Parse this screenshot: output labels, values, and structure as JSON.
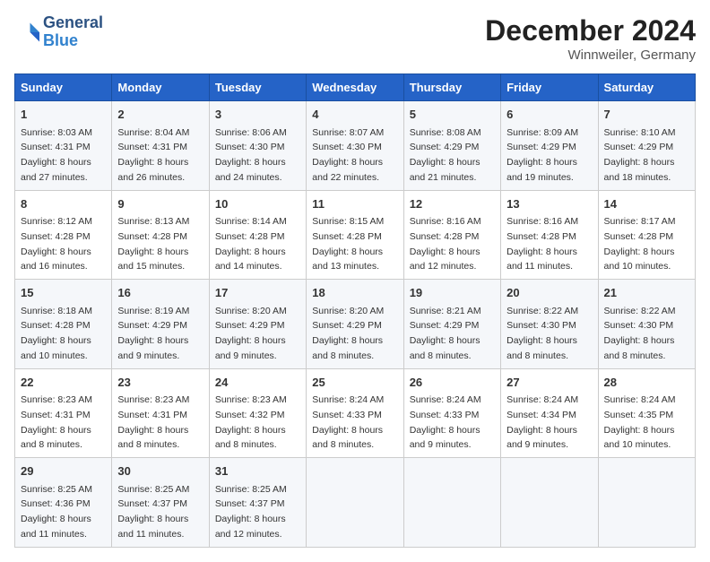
{
  "header": {
    "logo_line1": "General",
    "logo_line2": "Blue",
    "month": "December 2024",
    "location": "Winnweiler, Germany"
  },
  "weekdays": [
    "Sunday",
    "Monday",
    "Tuesday",
    "Wednesday",
    "Thursday",
    "Friday",
    "Saturday"
  ],
  "weeks": [
    [
      {
        "day": "1",
        "sunrise": "8:03 AM",
        "sunset": "4:31 PM",
        "daylight": "8 hours and 27 minutes."
      },
      {
        "day": "2",
        "sunrise": "8:04 AM",
        "sunset": "4:31 PM",
        "daylight": "8 hours and 26 minutes."
      },
      {
        "day": "3",
        "sunrise": "8:06 AM",
        "sunset": "4:30 PM",
        "daylight": "8 hours and 24 minutes."
      },
      {
        "day": "4",
        "sunrise": "8:07 AM",
        "sunset": "4:30 PM",
        "daylight": "8 hours and 22 minutes."
      },
      {
        "day": "5",
        "sunrise": "8:08 AM",
        "sunset": "4:29 PM",
        "daylight": "8 hours and 21 minutes."
      },
      {
        "day": "6",
        "sunrise": "8:09 AM",
        "sunset": "4:29 PM",
        "daylight": "8 hours and 19 minutes."
      },
      {
        "day": "7",
        "sunrise": "8:10 AM",
        "sunset": "4:29 PM",
        "daylight": "8 hours and 18 minutes."
      }
    ],
    [
      {
        "day": "8",
        "sunrise": "8:12 AM",
        "sunset": "4:28 PM",
        "daylight": "8 hours and 16 minutes."
      },
      {
        "day": "9",
        "sunrise": "8:13 AM",
        "sunset": "4:28 PM",
        "daylight": "8 hours and 15 minutes."
      },
      {
        "day": "10",
        "sunrise": "8:14 AM",
        "sunset": "4:28 PM",
        "daylight": "8 hours and 14 minutes."
      },
      {
        "day": "11",
        "sunrise": "8:15 AM",
        "sunset": "4:28 PM",
        "daylight": "8 hours and 13 minutes."
      },
      {
        "day": "12",
        "sunrise": "8:16 AM",
        "sunset": "4:28 PM",
        "daylight": "8 hours and 12 minutes."
      },
      {
        "day": "13",
        "sunrise": "8:16 AM",
        "sunset": "4:28 PM",
        "daylight": "8 hours and 11 minutes."
      },
      {
        "day": "14",
        "sunrise": "8:17 AM",
        "sunset": "4:28 PM",
        "daylight": "8 hours and 10 minutes."
      }
    ],
    [
      {
        "day": "15",
        "sunrise": "8:18 AM",
        "sunset": "4:28 PM",
        "daylight": "8 hours and 10 minutes."
      },
      {
        "day": "16",
        "sunrise": "8:19 AM",
        "sunset": "4:29 PM",
        "daylight": "8 hours and 9 minutes."
      },
      {
        "day": "17",
        "sunrise": "8:20 AM",
        "sunset": "4:29 PM",
        "daylight": "8 hours and 9 minutes."
      },
      {
        "day": "18",
        "sunrise": "8:20 AM",
        "sunset": "4:29 PM",
        "daylight": "8 hours and 8 minutes."
      },
      {
        "day": "19",
        "sunrise": "8:21 AM",
        "sunset": "4:29 PM",
        "daylight": "8 hours and 8 minutes."
      },
      {
        "day": "20",
        "sunrise": "8:22 AM",
        "sunset": "4:30 PM",
        "daylight": "8 hours and 8 minutes."
      },
      {
        "day": "21",
        "sunrise": "8:22 AM",
        "sunset": "4:30 PM",
        "daylight": "8 hours and 8 minutes."
      }
    ],
    [
      {
        "day": "22",
        "sunrise": "8:23 AM",
        "sunset": "4:31 PM",
        "daylight": "8 hours and 8 minutes."
      },
      {
        "day": "23",
        "sunrise": "8:23 AM",
        "sunset": "4:31 PM",
        "daylight": "8 hours and 8 minutes."
      },
      {
        "day": "24",
        "sunrise": "8:23 AM",
        "sunset": "4:32 PM",
        "daylight": "8 hours and 8 minutes."
      },
      {
        "day": "25",
        "sunrise": "8:24 AM",
        "sunset": "4:33 PM",
        "daylight": "8 hours and 8 minutes."
      },
      {
        "day": "26",
        "sunrise": "8:24 AM",
        "sunset": "4:33 PM",
        "daylight": "8 hours and 9 minutes."
      },
      {
        "day": "27",
        "sunrise": "8:24 AM",
        "sunset": "4:34 PM",
        "daylight": "8 hours and 9 minutes."
      },
      {
        "day": "28",
        "sunrise": "8:24 AM",
        "sunset": "4:35 PM",
        "daylight": "8 hours and 10 minutes."
      }
    ],
    [
      {
        "day": "29",
        "sunrise": "8:25 AM",
        "sunset": "4:36 PM",
        "daylight": "8 hours and 11 minutes."
      },
      {
        "day": "30",
        "sunrise": "8:25 AM",
        "sunset": "4:37 PM",
        "daylight": "8 hours and 11 minutes."
      },
      {
        "day": "31",
        "sunrise": "8:25 AM",
        "sunset": "4:37 PM",
        "daylight": "8 hours and 12 minutes."
      },
      null,
      null,
      null,
      null
    ]
  ]
}
